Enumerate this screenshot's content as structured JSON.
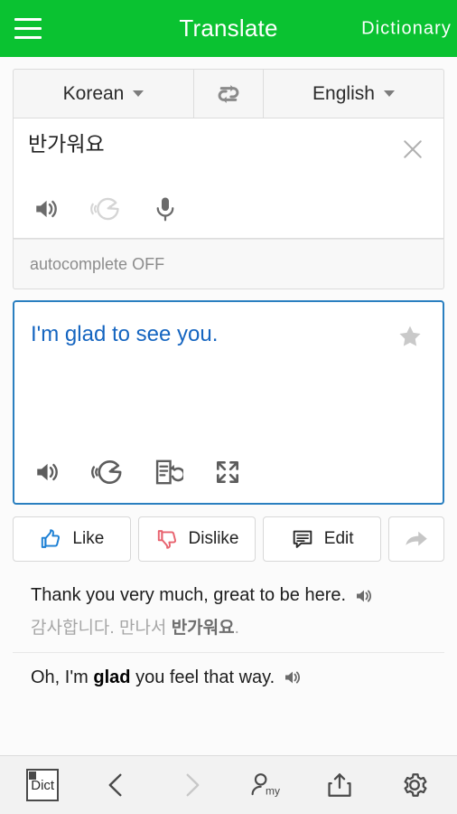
{
  "header": {
    "menu_icon": "hamburger-menu-icon",
    "title": "Translate",
    "action_label": "Dictionary",
    "background_color": "#0ac231",
    "text_color": "#ffffff"
  },
  "language_bar": {
    "source_language": "Korean",
    "target_language": "English",
    "swap_icon": "swap-languages-icon"
  },
  "source_panel": {
    "text": "반가워요",
    "clear_icon": "close-icon",
    "tools": [
      {
        "name": "speaker-icon",
        "label": "Listen",
        "enabled": true
      },
      {
        "name": "pronunciation-icon",
        "label": "Pronunciation",
        "enabled": false
      },
      {
        "name": "microphone-icon",
        "label": "Voice input",
        "enabled": true
      }
    ]
  },
  "autocomplete": {
    "label": "autocomplete OFF"
  },
  "result_panel": {
    "text": "I'm glad to see you.",
    "text_color": "#1565c0",
    "border_color": "#2a7fc0",
    "favorite_icon": "star-icon",
    "tools": [
      {
        "name": "speaker-icon",
        "label": "Listen"
      },
      {
        "name": "pronunciation-icon",
        "label": "Pronunciation"
      },
      {
        "name": "retranslate-icon",
        "label": "Re-translate"
      },
      {
        "name": "fullscreen-icon",
        "label": "Full screen"
      }
    ]
  },
  "feedback": {
    "like_label": "Like",
    "like_color": "#1b7fd4",
    "dislike_label": "Dislike",
    "dislike_color": "#e8636f",
    "edit_label": "Edit",
    "edit_color": "#2b2b2b",
    "share_icon": "share-arrow-icon"
  },
  "examples": [
    {
      "en_before": "Thank you very much, great to be here.",
      "en_bold": "",
      "en_after": "",
      "ko_before": "감사합니다. 만나서 ",
      "ko_bold": "반가워요",
      "ko_after": ".",
      "audio_icon": "speaker-icon"
    },
    {
      "en_before": "Oh, I'm ",
      "en_bold": "glad",
      "en_after": " you feel that way.",
      "ko_before": "",
      "ko_bold": "",
      "ko_after": "",
      "audio_icon": "speaker-icon"
    }
  ],
  "bottom_bar": {
    "items": [
      {
        "name": "dict-button",
        "icon": "dictionary-bookmark-icon",
        "label": "Dict",
        "enabled": true
      },
      {
        "name": "back-button",
        "icon": "chevron-left-icon",
        "label": "",
        "enabled": true
      },
      {
        "name": "forward-button",
        "icon": "chevron-right-icon",
        "label": "",
        "enabled": false
      },
      {
        "name": "my-button",
        "icon": "person-my-icon",
        "label": "my",
        "enabled": true
      },
      {
        "name": "share-button",
        "icon": "share-upload-icon",
        "label": "",
        "enabled": true
      },
      {
        "name": "settings-button",
        "icon": "gear-icon",
        "label": "",
        "enabled": true
      }
    ]
  }
}
